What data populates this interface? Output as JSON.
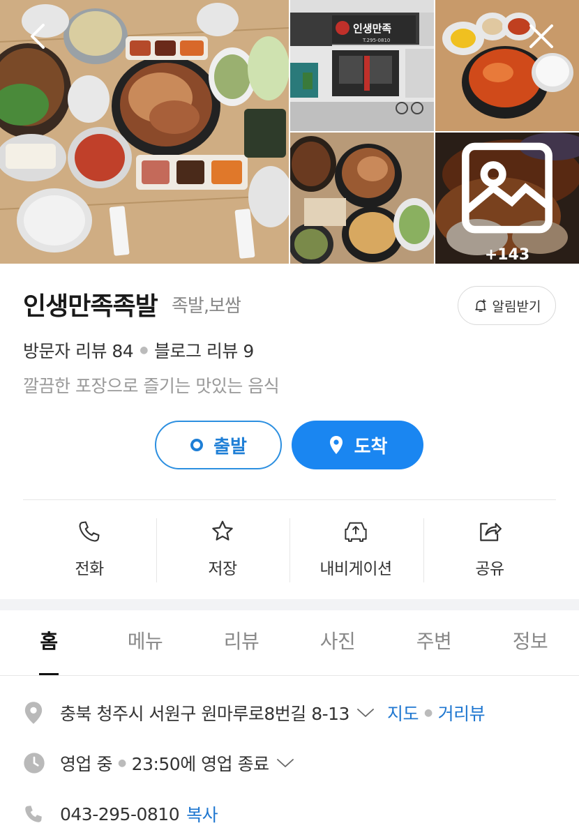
{
  "gallery": {
    "more_count": "+143"
  },
  "place": {
    "name": "인생만족족발",
    "category": "족발,보쌈",
    "alarm_label": "알림받기",
    "visitor_reviews": "방문자 리뷰 84",
    "blog_reviews": "블로그 리뷰 9",
    "description": "깔끔한 포장으로 즐기는 맛있는 음식"
  },
  "route": {
    "depart_label": "출발",
    "arrive_label": "도착"
  },
  "actions": [
    {
      "label": "전화",
      "icon": "phone-icon"
    },
    {
      "label": "저장",
      "icon": "star-icon"
    },
    {
      "label": "내비게이션",
      "icon": "car-icon"
    },
    {
      "label": "공유",
      "icon": "share-icon"
    }
  ],
  "tabs": [
    {
      "label": "홈",
      "active": true
    },
    {
      "label": "메뉴"
    },
    {
      "label": "리뷰"
    },
    {
      "label": "사진"
    },
    {
      "label": "주변"
    },
    {
      "label": "정보"
    }
  ],
  "info": {
    "address": "충북 청주시 서원구 원마루로8번길 8-13",
    "map_link": "지도",
    "street_view_link": "거리뷰",
    "hours_status": "영업 중",
    "hours_detail": "23:50에 영업 종료",
    "phone": "043-295-0810",
    "copy_label": "복사"
  },
  "store_sign": {
    "name": "인생만족",
    "phone": "T.295-0810"
  },
  "colors": {
    "primary": "#1a86f1",
    "link": "#1f77d0"
  }
}
